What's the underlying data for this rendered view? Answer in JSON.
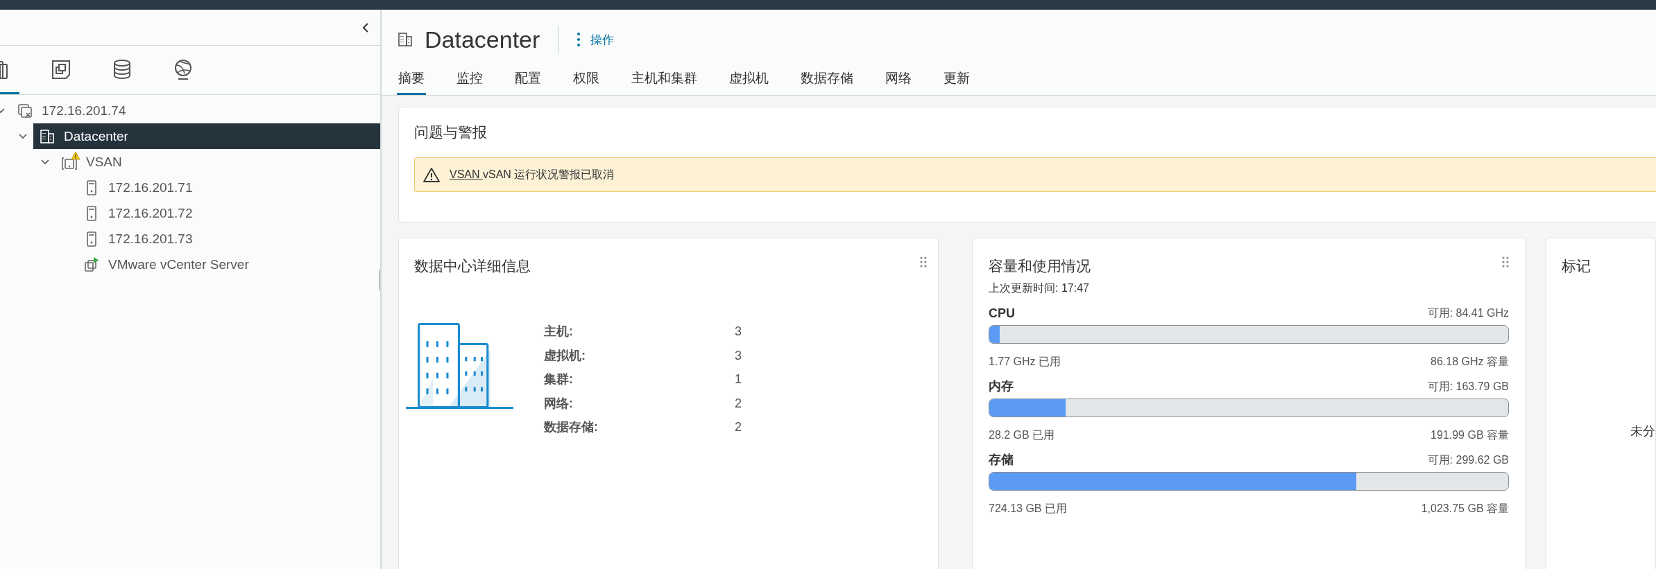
{
  "navigator": {
    "view_tabs": [
      {
        "kind": "hosts",
        "selected": true
      },
      {
        "kind": "vms",
        "selected": false
      },
      {
        "kind": "storage",
        "selected": false
      },
      {
        "kind": "network",
        "selected": false
      }
    ],
    "tree": [
      {
        "label": "172.16.201.74",
        "kind": "vcenter",
        "expanded": true,
        "selected": false,
        "children": [
          {
            "label": "Datacenter",
            "kind": "datacenter",
            "expanded": true,
            "selected": true,
            "children": [
              {
                "label": "VSAN",
                "kind": "cluster",
                "warning": true,
                "expanded": true,
                "selected": false,
                "children": [
                  {
                    "label": "172.16.201.71",
                    "kind": "host",
                    "selected": false
                  },
                  {
                    "label": "172.16.201.72",
                    "kind": "host",
                    "selected": false
                  },
                  {
                    "label": "172.16.201.73",
                    "kind": "host",
                    "selected": false
                  },
                  {
                    "label": "VMware vCenter Server",
                    "kind": "vm",
                    "selected": false
                  }
                ]
              }
            ]
          }
        ]
      }
    ]
  },
  "object": {
    "title": "Datacenter",
    "actions": "操作"
  },
  "tabs": [
    {
      "label": "摘要",
      "selected": true
    },
    {
      "label": "监控",
      "selected": false
    },
    {
      "label": "配置",
      "selected": false
    },
    {
      "label": "权限",
      "selected": false
    },
    {
      "label": "主机和集群",
      "selected": false
    },
    {
      "label": "虚拟机",
      "selected": false
    },
    {
      "label": "数据存储",
      "selected": false
    },
    {
      "label": "网络",
      "selected": false
    },
    {
      "label": "更新",
      "selected": false
    }
  ],
  "issues": {
    "title": "问题与警报",
    "alerts": [
      {
        "link": "VSAN",
        "message": "vSAN 运行状况警报已取消"
      }
    ]
  },
  "details": {
    "title": "数据中心详细信息",
    "rows": [
      {
        "label": "主机:",
        "value": "3"
      },
      {
        "label": "虚拟机:",
        "value": "3"
      },
      {
        "label": "集群:",
        "value": "1"
      },
      {
        "label": "网络:",
        "value": "2"
      },
      {
        "label": "数据存储:",
        "value": "2"
      }
    ]
  },
  "capacity": {
    "title": "容量和使用情况",
    "updated": "上次更新时间: 17:47",
    "meters": [
      {
        "name": "CPU",
        "free": "可用: 84.41 GHz",
        "level": 0.0205,
        "used": "1.77 GHz 已用",
        "total": "86.18 GHz 容量"
      },
      {
        "name": "内存",
        "free": "可用: 163.79 GB",
        "level": 0.147,
        "used": "28.2 GB 已用",
        "total": "191.99 GB 容量"
      },
      {
        "name": "存储",
        "free": "可用: 299.62 GB",
        "level": 0.707,
        "used": "724.13 GB 已用",
        "total": "1,023.75 GB 容量"
      }
    ]
  },
  "tags": {
    "title": "标记",
    "note": "未分"
  }
}
